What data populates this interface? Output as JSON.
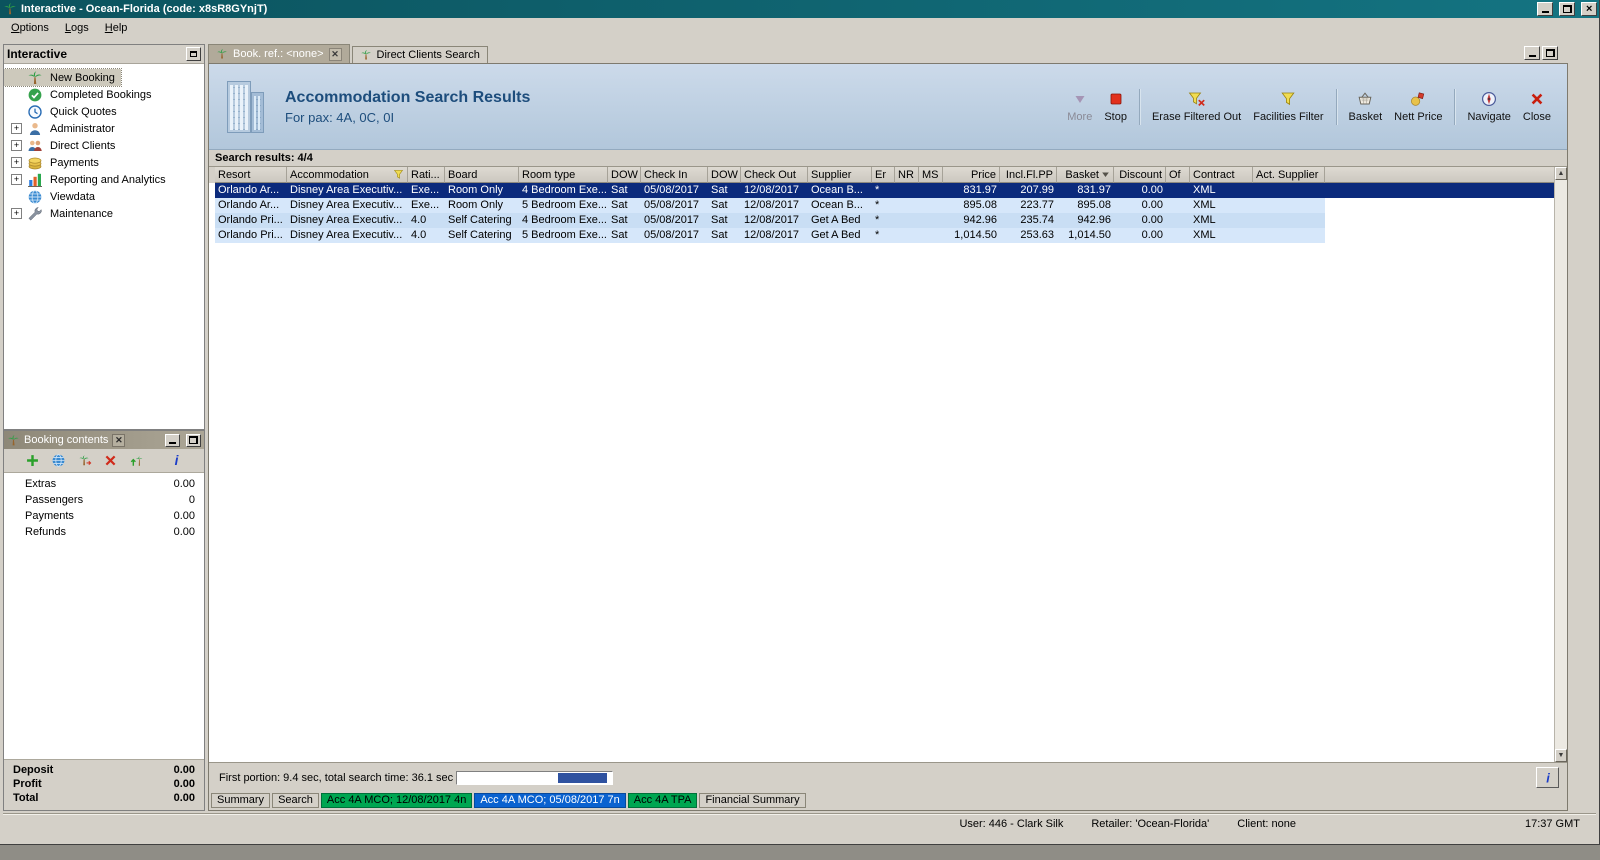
{
  "colors": {
    "titlebar": "#0c5a66",
    "selected_row": "#0b2a7c",
    "tab_green": "#00a651",
    "tab_blue": "#0a62d0",
    "header_text": "#1d4d7c"
  },
  "window": {
    "title": "Interactive - Ocean-Florida (code: x8sR8GYnjT)",
    "menu": [
      "Options",
      "Logs",
      "Help"
    ]
  },
  "sidebar": {
    "title": "Interactive",
    "items": [
      {
        "label": "New Booking",
        "icon": "palm-tree",
        "expandable": false,
        "selected": true
      },
      {
        "label": "Completed Bookings",
        "icon": "check-circle",
        "expandable": false,
        "selected": false
      },
      {
        "label": "Quick Quotes",
        "icon": "clock",
        "expandable": false,
        "selected": false
      },
      {
        "label": "Administrator",
        "icon": "person",
        "expandable": true,
        "selected": false
      },
      {
        "label": "Direct Clients",
        "icon": "people",
        "expandable": true,
        "selected": false
      },
      {
        "label": "Payments",
        "icon": "coins",
        "expandable": true,
        "selected": false
      },
      {
        "label": "Reporting and Analytics",
        "icon": "bar-chart",
        "expandable": true,
        "selected": false
      },
      {
        "label": "Viewdata",
        "icon": "globe",
        "expandable": false,
        "selected": false
      },
      {
        "label": "Maintenance",
        "icon": "tools",
        "expandable": true,
        "selected": false
      }
    ]
  },
  "booking_contents": {
    "title": "Booking contents",
    "tools": [
      {
        "name": "add",
        "icon": "add-plus"
      },
      {
        "name": "world",
        "icon": "globe"
      },
      {
        "name": "export",
        "icon": "palm-export"
      },
      {
        "name": "delete",
        "icon": "delete-x"
      },
      {
        "name": "upload",
        "icon": "palm-up"
      },
      {
        "name": "info",
        "icon": "info"
      }
    ],
    "rows": [
      {
        "label": "Extras",
        "value": "0.00"
      },
      {
        "label": "Passengers",
        "value": "0"
      },
      {
        "label": "Payments",
        "value": "0.00"
      },
      {
        "label": "Refunds",
        "value": "0.00"
      }
    ],
    "totals": [
      {
        "label": "Deposit",
        "value": "0.00"
      },
      {
        "label": "Profit",
        "value": "0.00"
      },
      {
        "label": "Total",
        "value": "0.00"
      }
    ]
  },
  "main": {
    "tabs": [
      {
        "label": "Book. ref.: <none>",
        "icon": "palm-tree",
        "active": true,
        "closable": true
      },
      {
        "label": "Direct Clients Search",
        "icon": "palm-tree",
        "active": false,
        "closable": false
      }
    ],
    "header": {
      "title": "Accommodation Search Results",
      "subtitle": "For pax: 4A, 0C, 0I"
    },
    "toolbar": [
      {
        "name": "more",
        "label": "More",
        "icon": "more-arrow",
        "disabled": true,
        "sep_before": false
      },
      {
        "name": "stop",
        "label": "Stop",
        "icon": "stop-square",
        "disabled": false,
        "sep_before": false
      },
      {
        "name": "erase-filtered-out",
        "label": "Erase Filtered Out",
        "icon": "erase-filter",
        "disabled": false,
        "sep_before": true
      },
      {
        "name": "facilities-filter",
        "label": "Facilities Filter",
        "icon": "filter-funnel",
        "disabled": false,
        "sep_before": false
      },
      {
        "name": "basket",
        "label": "Basket",
        "icon": "basket",
        "disabled": false,
        "sep_before": true
      },
      {
        "name": "nett-price",
        "label": "Nett Price",
        "icon": "nett-price",
        "disabled": false,
        "sep_before": false
      },
      {
        "name": "navigate",
        "label": "Navigate",
        "icon": "navigate-compass",
        "disabled": false,
        "sep_before": true
      },
      {
        "name": "close",
        "label": "Close",
        "icon": "close-x",
        "disabled": false,
        "sep_before": false
      }
    ],
    "results_label": "Search results: 4/4",
    "table": {
      "columns": [
        {
          "label": "Resort",
          "icon": ""
        },
        {
          "label": "Accommodation",
          "icon": "filter-funnel"
        },
        {
          "label": "Rati...",
          "icon": ""
        },
        {
          "label": "Board",
          "icon": ""
        },
        {
          "label": "Room type",
          "icon": ""
        },
        {
          "label": "DOW",
          "icon": ""
        },
        {
          "label": "Check In",
          "icon": ""
        },
        {
          "label": "DOW",
          "icon": ""
        },
        {
          "label": "Check Out",
          "icon": ""
        },
        {
          "label": "Supplier",
          "icon": ""
        },
        {
          "label": "Er",
          "icon": ""
        },
        {
          "label": "NR",
          "icon": ""
        },
        {
          "label": "MS",
          "icon": ""
        },
        {
          "label": "Price",
          "icon": ""
        },
        {
          "label": "Incl.Fl.PP",
          "icon": ""
        },
        {
          "label": "Basket",
          "icon": "sort-desc"
        },
        {
          "label": "Discount",
          "icon": ""
        },
        {
          "label": "Of",
          "icon": ""
        },
        {
          "label": "Contract",
          "icon": ""
        },
        {
          "label": "Act. Supplier",
          "icon": ""
        }
      ],
      "rows": [
        {
          "selected": true,
          "cells": [
            "Orlando Ar...",
            "Disney Area Executiv...",
            "Exe...",
            "Room Only",
            "4 Bedroom Exe...",
            "Sat",
            "05/08/2017",
            "Sat",
            "12/08/2017",
            "Ocean B...",
            "*",
            "",
            "",
            "831.97",
            "207.99",
            "831.97",
            "0.00",
            "",
            "XML",
            ""
          ]
        },
        {
          "selected": false,
          "cells": [
            "Orlando Ar...",
            "Disney Area Executiv...",
            "Exe...",
            "Room Only",
            "5 Bedroom Exe...",
            "Sat",
            "05/08/2017",
            "Sat",
            "12/08/2017",
            "Ocean B...",
            "*",
            "",
            "",
            "895.08",
            "223.77",
            "895.08",
            "0.00",
            "",
            "XML",
            ""
          ]
        },
        {
          "selected": false,
          "cells": [
            "Orlando Pri...",
            "Disney Area Executiv...",
            "4.0",
            "Self Catering",
            "4 Bedroom Exe...",
            "Sat",
            "05/08/2017",
            "Sat",
            "12/08/2017",
            "Get A Bed",
            "*",
            "",
            "",
            "942.96",
            "235.74",
            "942.96",
            "0.00",
            "",
            "XML",
            ""
          ]
        },
        {
          "selected": false,
          "cells": [
            "Orlando Pri...",
            "Disney Area Executiv...",
            "4.0",
            "Self Catering",
            "5 Bedroom Exe...",
            "Sat",
            "05/08/2017",
            "Sat",
            "12/08/2017",
            "Get A Bed",
            "*",
            "",
            "",
            "1,014.50",
            "253.63",
            "1,014.50",
            "0.00",
            "",
            "XML",
            ""
          ]
        }
      ]
    },
    "progress": {
      "text": "First portion: 9.4 sec, total search time: 36.1 sec",
      "fill_left_pct": 65,
      "fill_width_pct": 32
    },
    "bottom_tabs": [
      {
        "label": "Summary",
        "style": "plain",
        "active": false
      },
      {
        "label": "Search",
        "style": "plain",
        "active": false
      },
      {
        "label": "Acc 4A MCO; 12/08/2017 4n",
        "style": "green",
        "active": false
      },
      {
        "label": "Acc 4A MCO; 05/08/2017 7n",
        "style": "blue",
        "active": true
      },
      {
        "label": "Acc 4A TPA",
        "style": "green",
        "active": false
      },
      {
        "label": "Financial Summary",
        "style": "plain",
        "active": false
      }
    ]
  },
  "statusbar": {
    "user": "User: 446 - Clark Silk",
    "retailer": "Retailer: 'Ocean-Florida'",
    "client": "Client: none",
    "time": "17:37 GMT"
  }
}
